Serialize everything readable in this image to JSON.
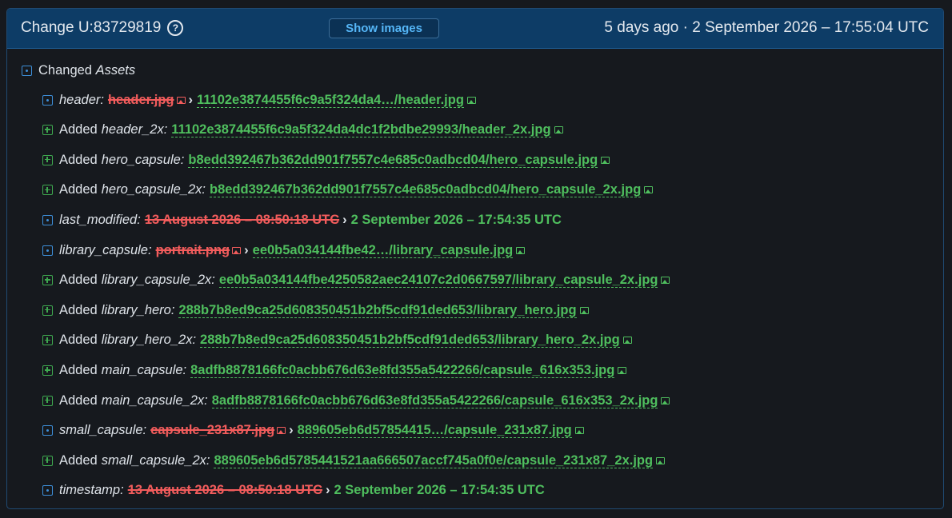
{
  "header": {
    "change_label": "Change U:83729819",
    "help_glyph": "?",
    "show_images_label": "Show images",
    "timestamp": "5 days ago · 2 September 2026 – 17:55:04 UTC"
  },
  "section": {
    "label": "Changed",
    "label_italic": "Assets"
  },
  "colors": {
    "removed": "#f25c5c",
    "added": "#4fbf5e",
    "modified_icon": "#3d8fd9",
    "header_bg": "#0d3c66",
    "button_text": "#55b6f7"
  },
  "rows": [
    {
      "kind": "mod",
      "key": "header:",
      "old": "header.jpg",
      "old_img": true,
      "new": "11102e3874455f6c9a5f324da4…/header.jpg",
      "new_img": true
    },
    {
      "kind": "add",
      "verb": "Added",
      "key": "header_2x:",
      "new": "11102e3874455f6c9a5f324da4dc1f2bdbe29993/header_2x.jpg",
      "new_img": true
    },
    {
      "kind": "add",
      "verb": "Added",
      "key": "hero_capsule:",
      "new": "b8edd392467b362dd901f7557c4e685c0adbcd04/hero_capsule.jpg",
      "new_img": true
    },
    {
      "kind": "add",
      "verb": "Added",
      "key": "hero_capsule_2x:",
      "new": "b8edd392467b362dd901f7557c4e685c0adbcd04/hero_capsule_2x.jpg",
      "new_img": true
    },
    {
      "kind": "mod",
      "key": "last_modified:",
      "old": "13 August 2026 – 08:50:18 UTC",
      "old_img": false,
      "new": "2 September 2026 – 17:54:35 UTC",
      "new_img": false
    },
    {
      "kind": "mod",
      "key": "library_capsule:",
      "old": "portrait.png",
      "old_img": true,
      "new": "ee0b5a034144fbe42…/library_capsule.jpg",
      "new_img": true
    },
    {
      "kind": "add",
      "verb": "Added",
      "key": "library_capsule_2x:",
      "new": "ee0b5a034144fbe4250582aec24107c2d0667597/library_capsule_2x.jpg",
      "new_img": true
    },
    {
      "kind": "add",
      "verb": "Added",
      "key": "library_hero:",
      "new": "288b7b8ed9ca25d608350451b2bf5cdf91ded653/library_hero.jpg",
      "new_img": true
    },
    {
      "kind": "add",
      "verb": "Added",
      "key": "library_hero_2x:",
      "new": "288b7b8ed9ca25d608350451b2bf5cdf91ded653/library_hero_2x.jpg",
      "new_img": true
    },
    {
      "kind": "add",
      "verb": "Added",
      "key": "main_capsule:",
      "new": "8adfb8878166fc0acbb676d63e8fd355a5422266/capsule_616x353.jpg",
      "new_img": true
    },
    {
      "kind": "add",
      "verb": "Added",
      "key": "main_capsule_2x:",
      "new": "8adfb8878166fc0acbb676d63e8fd355a5422266/capsule_616x353_2x.jpg",
      "new_img": true
    },
    {
      "kind": "mod",
      "key": "small_capsule:",
      "old": "capsule_231x87.jpg",
      "old_img": true,
      "new": "889605eb6d57854415…/capsule_231x87.jpg",
      "new_img": true
    },
    {
      "kind": "add",
      "verb": "Added",
      "key": "small_capsule_2x:",
      "new": "889605eb6d5785441521aa666507accf745a0f0e/capsule_231x87_2x.jpg",
      "new_img": true
    },
    {
      "kind": "mod",
      "key": "timestamp:",
      "old": "13 August 2026 – 08:50:18 UTC",
      "old_img": false,
      "new": "2 September 2026 – 17:54:35 UTC",
      "new_img": false
    }
  ]
}
